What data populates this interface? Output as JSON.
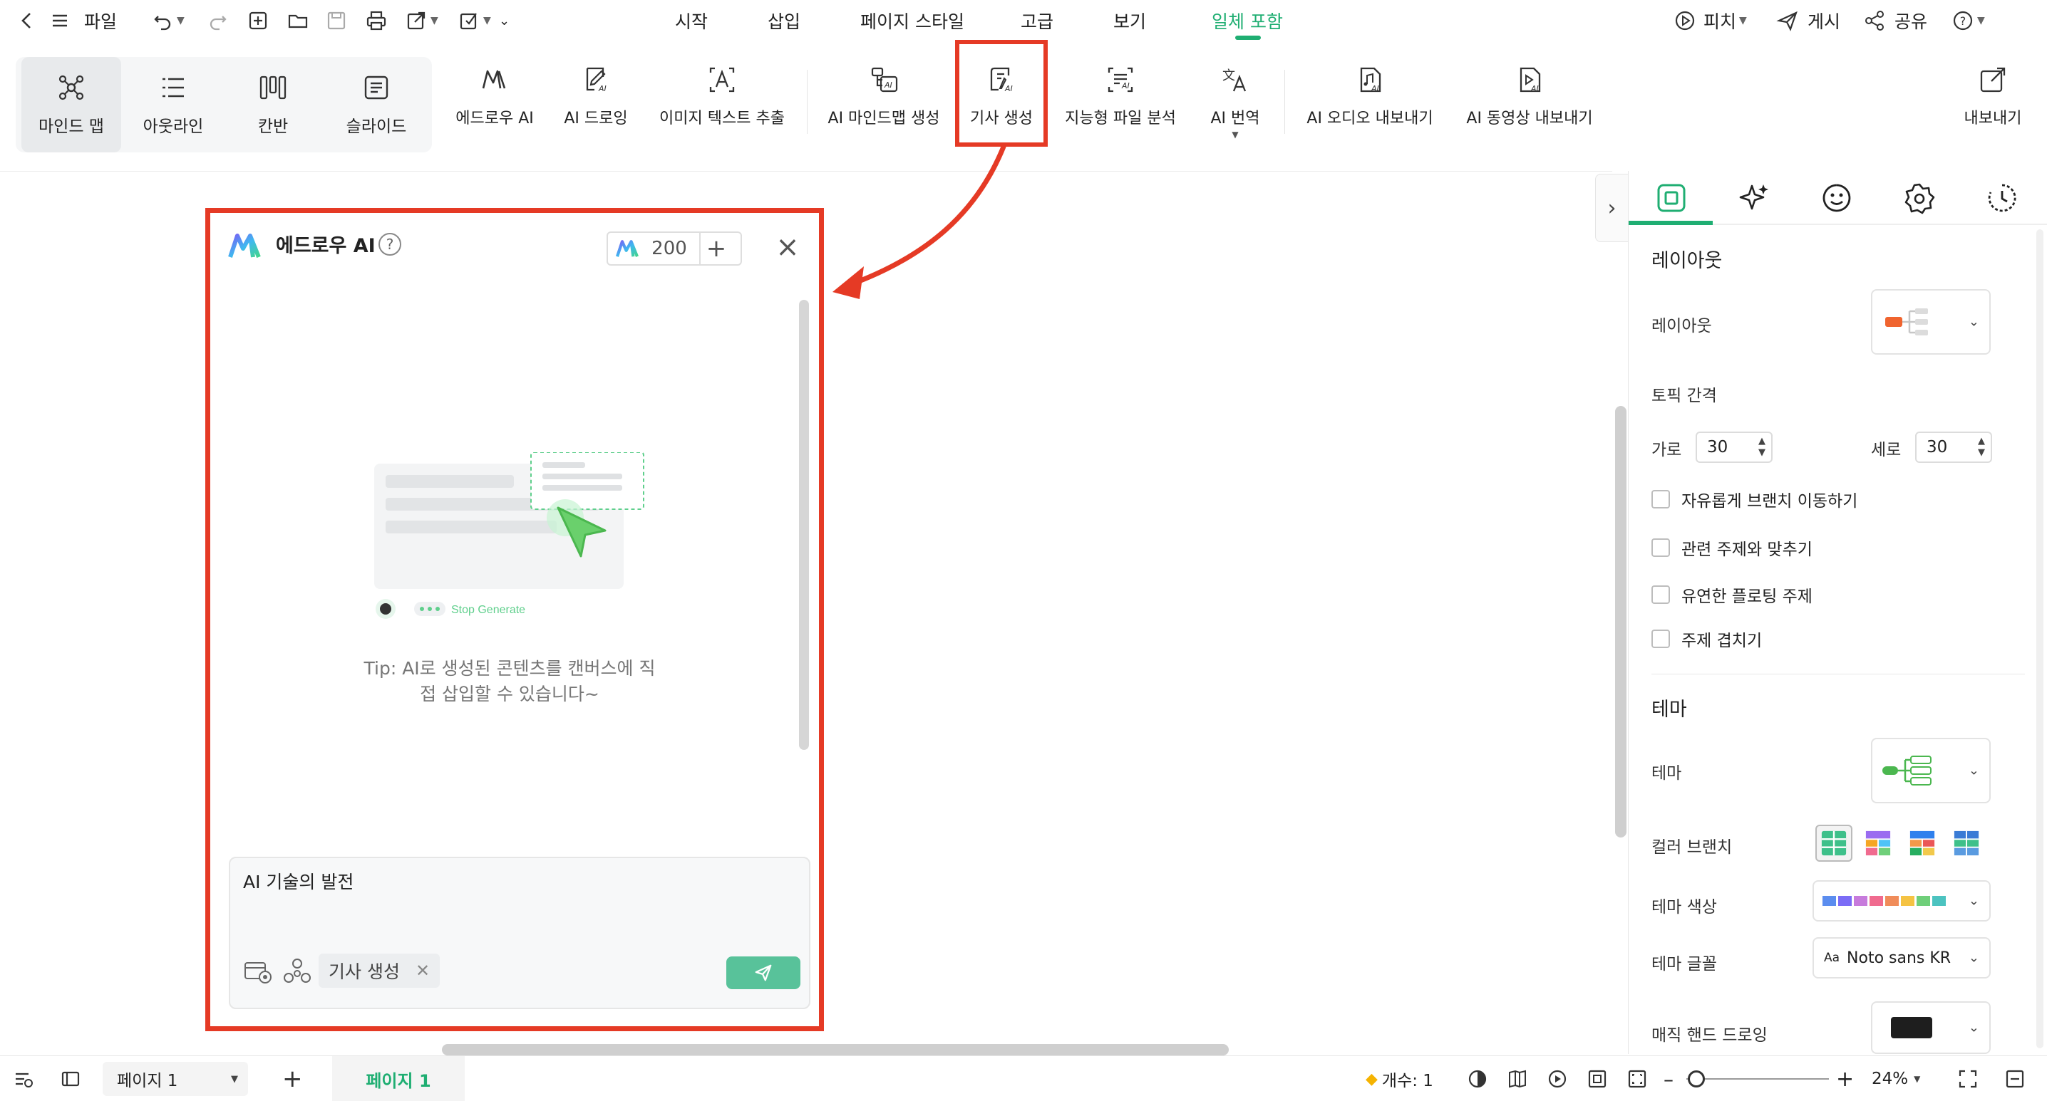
{
  "menubar": {
    "file_label": "파일",
    "tabs": [
      "시작",
      "삽입",
      "페이지 스타일",
      "고급",
      "보기",
      "일체 포함"
    ],
    "active_tab": "일체 포함",
    "pitch_label": "피치",
    "publish_label": "게시",
    "share_label": "공유"
  },
  "ribbon": {
    "views": [
      "마인드 맵",
      "아웃라인",
      "칸반",
      "슬라이드"
    ],
    "buttons": [
      "에드로우 AI",
      "AI 드로잉",
      "이미지 텍스트 추출",
      "AI 마인드맵 생성",
      "기사 생성",
      "지능형 파일 분석",
      "AI 번역",
      "AI 오디오 내보내기",
      "AI 동영상 내보내기"
    ],
    "export_label": "내보내기",
    "highlighted": "기사 생성"
  },
  "ai_panel": {
    "title": "에드로우 AI",
    "credits": "200",
    "illustration_label": "Stop Generate",
    "tip": "Tip: AI로 생성된 콘텐츠를 캔버스에 직접 삽입할 수 있습니다~",
    "tip_line1": "Tip: AI로 생성된 콘텐츠를 캔버스에 직",
    "tip_line2": "접 삽입할 수 있습니다~",
    "input_value": "AI 기술의 발전",
    "chip_label": "기사 생성"
  },
  "right_panel": {
    "layout_heading": "레이아웃",
    "layout_label": "레이아웃",
    "topic_spacing_label": "토픽 간격",
    "horizontal_label": "가로",
    "horizontal_value": "30",
    "vertical_label": "세로",
    "vertical_value": "30",
    "checkboxes": [
      "자유롭게 브랜치 이동하기",
      "관련 주제와 맞추기",
      "유연한 플로팅 주제",
      "주제 겹치기"
    ],
    "theme_heading": "테마",
    "theme_label": "테마",
    "color_branch_label": "컬러 브랜치",
    "theme_color_label": "테마 색상",
    "theme_font_label": "테마 글꼴",
    "theme_font_value": "Noto sans KR",
    "font_prefix": "Aa",
    "hand_drawing_label": "매직 핸드 드로잉",
    "theme_colors": [
      "#5b8def",
      "#7b6cf6",
      "#c77bdc",
      "#f06b8f",
      "#f08c5a",
      "#f5c343",
      "#6fcf7a",
      "#4cc3c0"
    ]
  },
  "statusbar": {
    "page_select": "페이지 1",
    "page_tab": "페이지 1",
    "count_label": "개수: 1",
    "zoom": "24%"
  },
  "colors": {
    "accent": "#1fae72",
    "highlight": "#e53a25",
    "send": "#58c29a"
  }
}
